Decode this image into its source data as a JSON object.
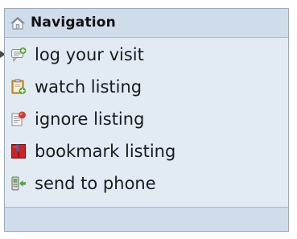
{
  "navigation": {
    "title": "Navigation",
    "title_icon": "home-icon",
    "items": [
      {
        "label": "log your visit",
        "icon": "log-visit-icon"
      },
      {
        "label": "watch listing",
        "icon": "watch-listing-icon"
      },
      {
        "label": "ignore listing",
        "icon": "ignore-listing-icon"
      },
      {
        "label": "bookmark listing",
        "icon": "bookmark-icon"
      },
      {
        "label": "send to phone",
        "icon": "send-phone-icon"
      }
    ]
  },
  "colors": {
    "panel_background": "#e2ebf4",
    "header_background": "#cfdcea",
    "border": "#97acc2"
  }
}
